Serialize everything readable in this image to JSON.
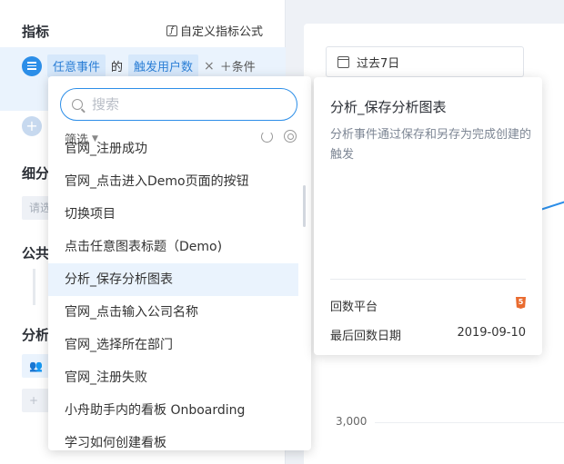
{
  "left": {
    "metric_title": "指标",
    "custom_formula": "自定义指标公式",
    "metric_row": {
      "event": "任意事件",
      "of": "的",
      "measure": "触发用户数",
      "close": "×",
      "add_condition": "＋条件"
    },
    "breakdown_label": "细分",
    "breakdown_placeholder": "请选",
    "common_label": "公共",
    "analysis_label": "分析"
  },
  "right": {
    "date_range": "过去7日",
    "y_tick": "3,000"
  },
  "dropdown": {
    "search_placeholder": "搜索",
    "filter_label": "筛选",
    "items": [
      "官网_注册成功",
      "官网_点击进入Demo页面的按钮",
      "切换项目",
      "点击任意图表标题（Demo)",
      "分析_保存分析图表",
      "官网_点击输入公司名称",
      "官网_选择所在部门",
      "官网_注册失败",
      "小舟助手内的看板 Onboarding",
      "学习如何创建看板"
    ]
  },
  "tooltip": {
    "title": "分析_保存分析图表",
    "description": "分析事件通过保存和另存为完成创建的触发",
    "platform_label": "回数平台",
    "last_date_label": "最后回数日期",
    "last_date_value": "2019-09-10"
  },
  "colors": {
    "accent": "#2c8ee8",
    "html5": "#e96b2f"
  }
}
